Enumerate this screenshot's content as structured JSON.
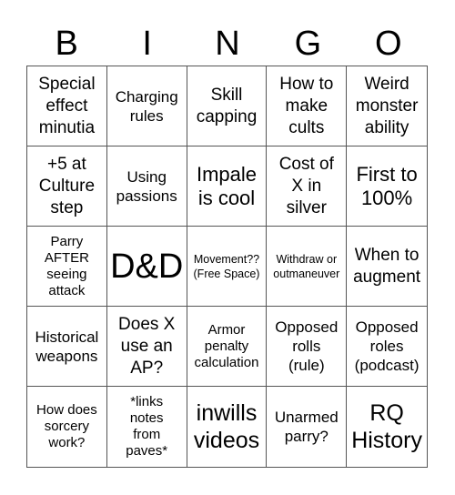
{
  "header": {
    "letters": [
      "B",
      "I",
      "N",
      "G",
      "O"
    ]
  },
  "cells": [
    {
      "text": "Special\neffect\nminutia",
      "size": "s-lg"
    },
    {
      "text": "Charging\nrules",
      "size": "s-md"
    },
    {
      "text": "Skill\ncapping",
      "size": "s-lg"
    },
    {
      "text": "How to\nmake\ncults",
      "size": "s-lg"
    },
    {
      "text": "Weird\nmonster\nability",
      "size": "s-lg"
    },
    {
      "text": "+5 at\nCulture\nstep",
      "size": "s-lg"
    },
    {
      "text": "Using\npassions",
      "size": "s-md"
    },
    {
      "text": "Impale\nis cool",
      "size": "s-xl"
    },
    {
      "text": "Cost of\nX in\nsilver",
      "size": "s-lg"
    },
    {
      "text": "First to\n100%",
      "size": "s-xl"
    },
    {
      "text": "Parry\nAFTER\nseeing\nattack",
      "size": "s-sm"
    },
    {
      "text": "D&D",
      "size": "s-huge"
    },
    {
      "text": "Movement??\n(Free Space)",
      "size": "s-xs"
    },
    {
      "text": "Withdraw or\noutmaneuver",
      "size": "s-xs"
    },
    {
      "text": "When to\naugment",
      "size": "s-lg"
    },
    {
      "text": "Historical\nweapons",
      "size": "s-md"
    },
    {
      "text": "Does X\nuse an\nAP?",
      "size": "s-lg"
    },
    {
      "text": "Armor\npenalty\ncalculation",
      "size": "s-sm"
    },
    {
      "text": "Opposed\nrolls\n(rule)",
      "size": "s-md"
    },
    {
      "text": "Opposed\nroles\n(podcast)",
      "size": "s-md"
    },
    {
      "text": "How does\nsorcery\nwork?",
      "size": "s-sm"
    },
    {
      "text": "*links\nnotes\nfrom\npaves*",
      "size": "s-sm"
    },
    {
      "text": "inwills\nvideos",
      "size": "s-xxl"
    },
    {
      "text": "Unarmed\nparry?",
      "size": "s-md"
    },
    {
      "text": "RQ\nHistory",
      "size": "s-xxl"
    }
  ]
}
